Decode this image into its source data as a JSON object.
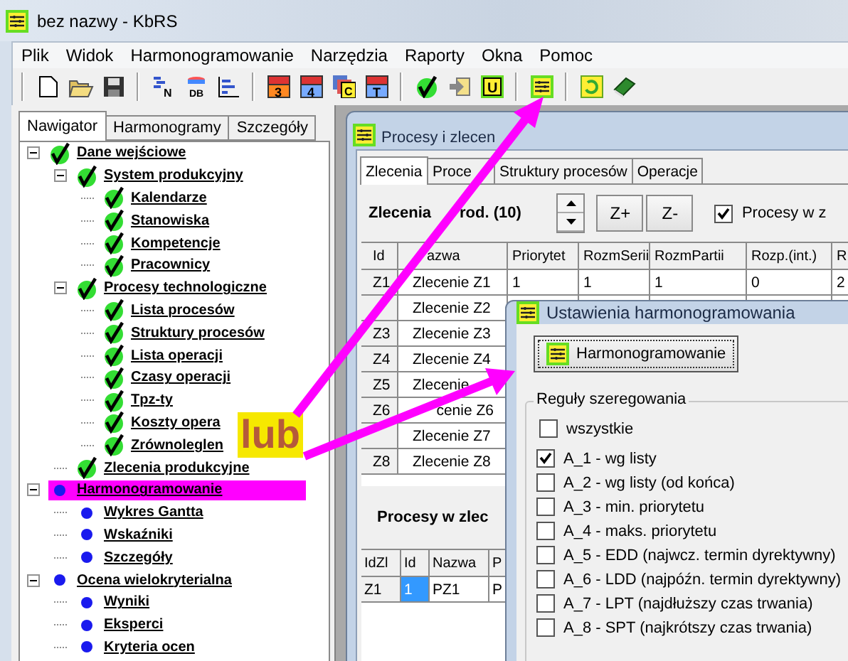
{
  "window": {
    "title": "bez nazwy - KbRS"
  },
  "menu": [
    "Plik",
    "Widok",
    "Harmonogramowanie",
    "Narzędzia",
    "Raporty",
    "Okna",
    "Pomoc"
  ],
  "toolbar": [
    {
      "kind": "new"
    },
    {
      "kind": "open"
    },
    {
      "kind": "save"
    },
    {
      "kind": "sep"
    },
    {
      "kind": "list",
      "glyph": "N"
    },
    {
      "kind": "db",
      "glyph": "DB"
    },
    {
      "kind": "chart"
    },
    {
      "kind": "sep"
    },
    {
      "kind": "tile",
      "glyph": "3"
    },
    {
      "kind": "tile",
      "glyph": "4"
    },
    {
      "kind": "stack",
      "glyph": "C"
    },
    {
      "kind": "tile",
      "glyph": "T"
    },
    {
      "kind": "sep"
    },
    {
      "kind": "check"
    },
    {
      "kind": "arrow"
    },
    {
      "kind": "letter",
      "glyph": "U"
    },
    {
      "kind": "sep"
    },
    {
      "kind": "schedule"
    },
    {
      "kind": "sep"
    },
    {
      "kind": "refresh"
    },
    {
      "kind": "book"
    }
  ],
  "navigator": {
    "tabs": [
      {
        "label": "Nawigator",
        "selected": true
      },
      {
        "label": "Harmonogramy",
        "selected": false
      },
      {
        "label": "Szczegóły",
        "selected": false
      }
    ],
    "tree": [
      {
        "label": "Dane wejściowe",
        "kind": "check",
        "expanded": true,
        "children": [
          {
            "label": "System produkcyjny",
            "kind": "check",
            "expanded": true,
            "children": [
              {
                "label": "Kalendarze",
                "kind": "check"
              },
              {
                "label": "Stanowiska",
                "kind": "check"
              },
              {
                "label": "Kompetencje",
                "kind": "check"
              },
              {
                "label": "Pracownicy",
                "kind": "check"
              }
            ]
          },
          {
            "label": "Procesy technologiczne",
            "kind": "check",
            "expanded": true,
            "children": [
              {
                "label": "Lista procesów",
                "kind": "check"
              },
              {
                "label": "Struktury procesów",
                "kind": "check"
              },
              {
                "label": "Lista operacji",
                "kind": "check"
              },
              {
                "label": "Czasy operacji",
                "kind": "check"
              },
              {
                "label": "Tpz-ty",
                "kind": "check"
              },
              {
                "label": "Koszty opera",
                "kind": "check"
              },
              {
                "label": "Zrównoleglen",
                "kind": "check"
              }
            ]
          },
          {
            "label": "Zlecenia produkcyjne",
            "kind": "check"
          }
        ]
      },
      {
        "label": "Harmonogramowanie",
        "kind": "dot",
        "expanded": true,
        "highlighted": true,
        "children": [
          {
            "label": "Wykres Gantta",
            "kind": "dot"
          },
          {
            "label": "Wskaźniki",
            "kind": "dot"
          },
          {
            "label": "Szczegóły",
            "kind": "dot"
          }
        ]
      },
      {
        "label": "Ocena wielokryterialna",
        "kind": "dot",
        "expanded": true,
        "children": [
          {
            "label": "Wyniki",
            "kind": "dot"
          },
          {
            "label": "Eksperci",
            "kind": "dot"
          },
          {
            "label": "Kryteria ocen",
            "kind": "dot"
          }
        ]
      }
    ]
  },
  "child_window": {
    "title": "Procesy i zlecen",
    "tabs": [
      {
        "label": "Zlecenia",
        "selected": true
      },
      {
        "label": "Proce",
        "selected": false
      },
      {
        "label": "Struktury procesów",
        "selected": false
      },
      {
        "label": "Operacje",
        "selected": false
      }
    ],
    "orders_heading": [
      "Zlecenia",
      "rod. (10)"
    ],
    "buttons": [
      "Z+",
      "Z-"
    ],
    "processes_toggle": {
      "label": "Procesy w z",
      "checked": true
    },
    "orders_table": {
      "columns": [
        "Id",
        "azwa",
        "Priorytet",
        "RozmSerii",
        "RozmPartii",
        "Rozp.(int.)",
        "R"
      ],
      "rows": [
        [
          "Z1",
          "Zlecenie Z1",
          "1",
          "1",
          "1",
          "0",
          "2"
        ],
        [
          null,
          "Zlecenie Z2"
        ],
        [
          "Z3",
          "Zlecenie Z3"
        ],
        [
          "Z4",
          "Zlecenie Z4"
        ],
        [
          "Z5",
          "Zlecenie"
        ],
        [
          "Z6",
          {
            "text": "cenie Z6",
            "kind": "tail"
          }
        ],
        [
          null,
          "Zlecenie Z7"
        ],
        [
          "Z8",
          "Zlecenie Z8"
        ]
      ]
    },
    "processes_heading": "Procesy w zlec",
    "processes_table": {
      "columns": [
        "IdZl",
        "Id",
        "Nazwa",
        "P"
      ],
      "rows": [
        {
          "cells": [
            {
              "text": "Z1",
              "selected": false
            },
            {
              "text": "1",
              "selected": true
            },
            {
              "text": "PZ1",
              "selected": false
            },
            {
              "text": "P",
              "selected": false
            }
          ]
        }
      ]
    }
  },
  "dialog": {
    "title": "Ustawienia harmonogramowania",
    "run_button": "Harmonogramowanie",
    "rules": {
      "title": "Reguły szeregowania",
      "all": {
        "label": "wszystkie",
        "checked": false
      },
      "items": [
        {
          "label": "A_1 - wg listy",
          "checked": true
        },
        {
          "label": "A_2 - wg listy (od końca)",
          "checked": false
        },
        {
          "label": "A_3 - min. priorytetu",
          "checked": false
        },
        {
          "label": "A_4 - maks. priorytetu",
          "checked": false
        },
        {
          "label": "A_5 - EDD (najwcz. termin dyrektywny)",
          "checked": false
        },
        {
          "label": "A_6 - LDD (najpóźn. termin dyrektywny)",
          "checked": false
        },
        {
          "label": "A_7 - LPT (najdłuższy czas trwania)",
          "checked": false
        },
        {
          "label": "A_8 - SPT (najkrótszy czas trwania)",
          "checked": false
        }
      ]
    }
  },
  "annotation": {
    "callout": "lub"
  }
}
